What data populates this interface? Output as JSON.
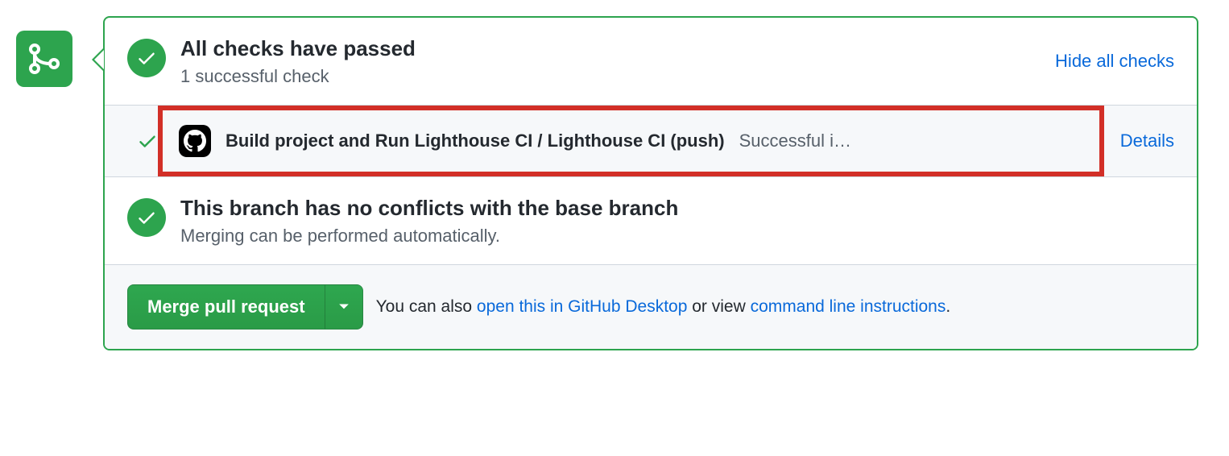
{
  "checks": {
    "title": "All checks have passed",
    "subtitle": "1 successful check",
    "toggle_label": "Hide all checks",
    "items": [
      {
        "name": "Build project and Run Lighthouse CI / Lighthouse CI (push)",
        "status": "Successful i…",
        "details_label": "Details"
      }
    ]
  },
  "conflicts": {
    "title": "This branch has no conflicts with the base branch",
    "subtitle": "Merging can be performed automatically."
  },
  "merge": {
    "button_label": "Merge pull request",
    "hint_prefix": "You can also ",
    "link_desktop": "open this in GitHub Desktop",
    "hint_middle": " or view ",
    "link_cli": "command line instructions",
    "hint_suffix": "."
  }
}
